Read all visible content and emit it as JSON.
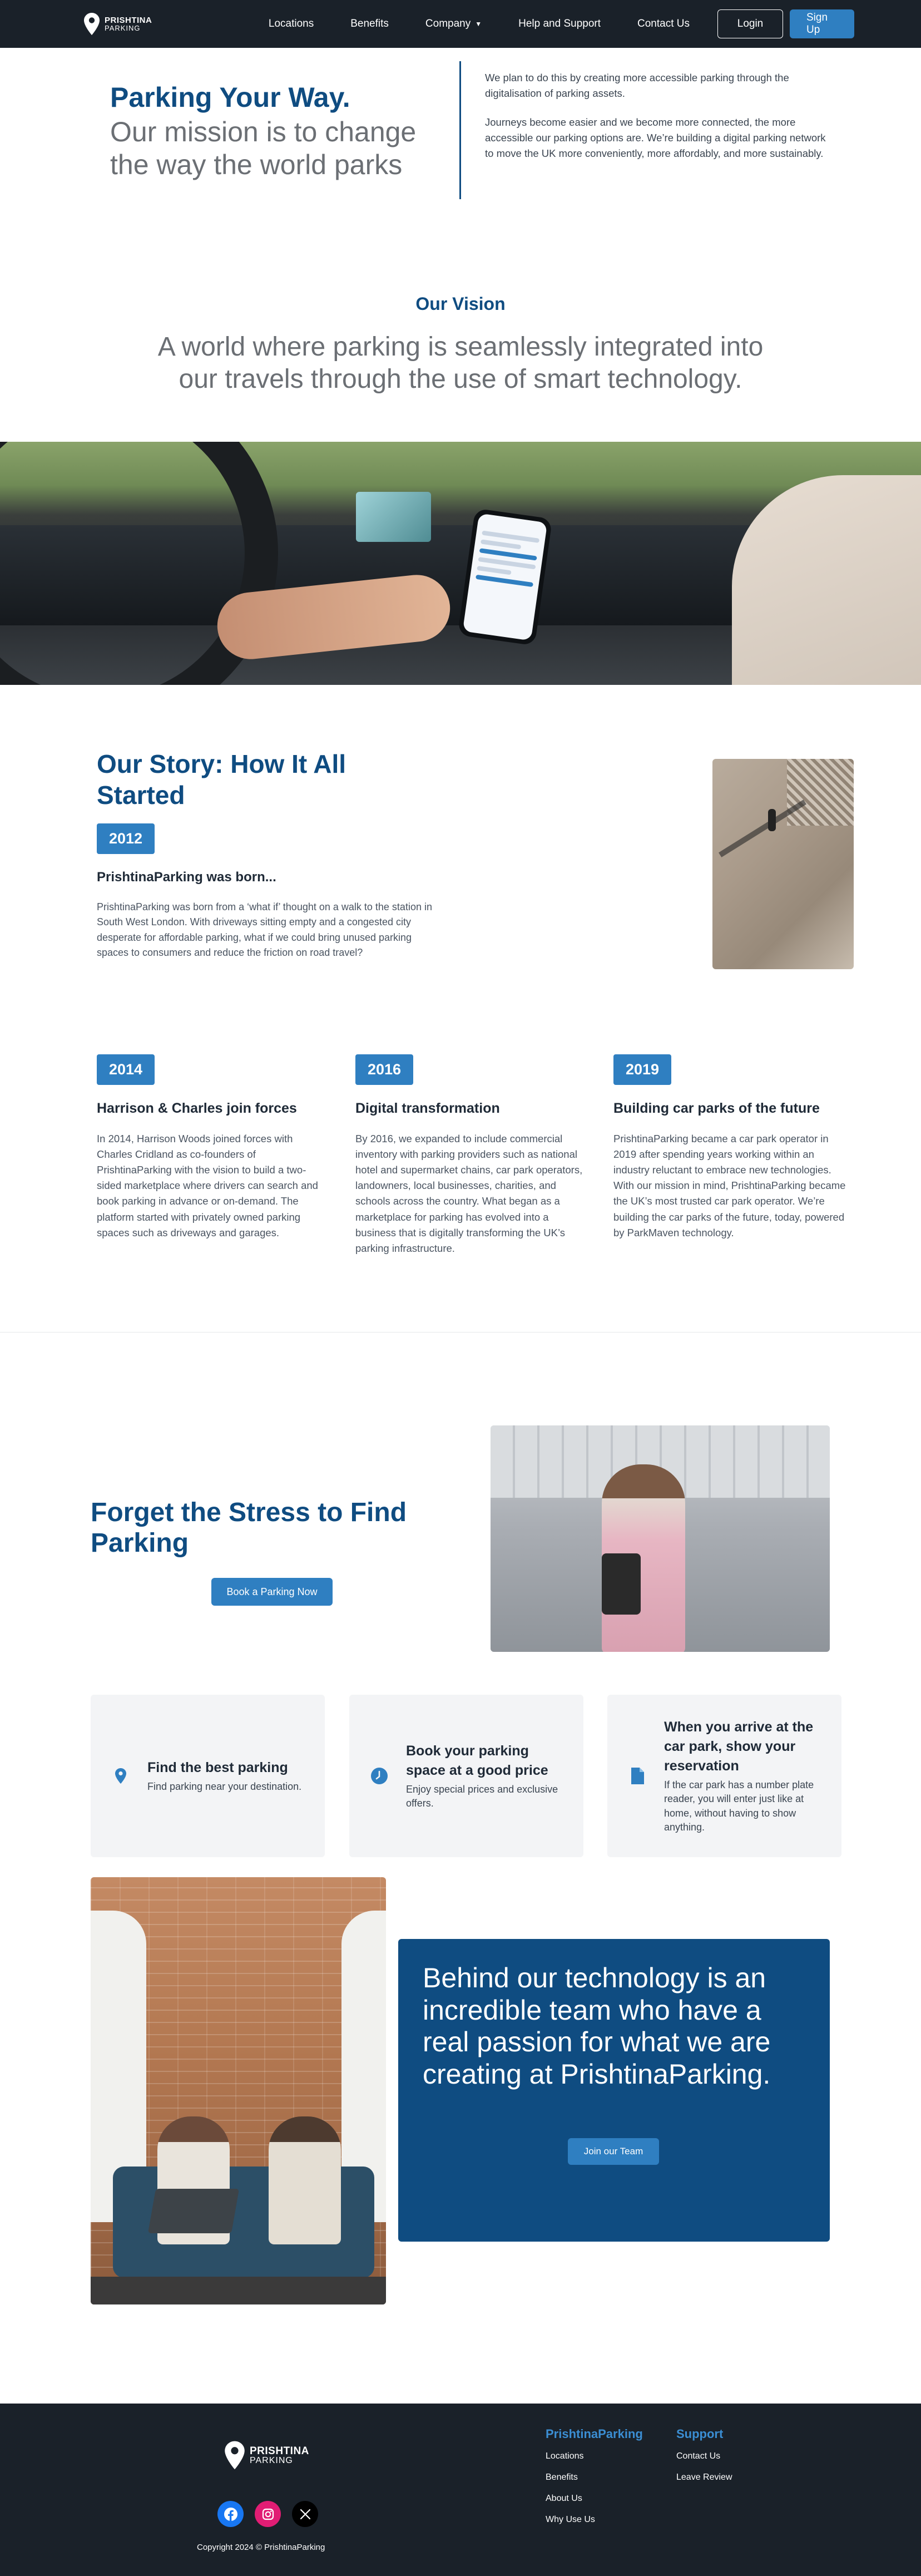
{
  "brand": {
    "name_line1": "PRISHTINA",
    "name_line2": "PARKING"
  },
  "nav": {
    "links": [
      "Locations",
      "Benefits",
      "Company",
      "Help and Support",
      "Contact Us"
    ],
    "login": "Login",
    "signup": "Sign Up"
  },
  "mission": {
    "title": "Parking Your Way.",
    "subtitle": "Our mission is to change the way the world parks",
    "p1": "We plan to do this by creating more accessible parking through the digitalisation of parking assets.",
    "p2": "Journeys become easier and we become more connected, the more accessible our parking options are. We’re building a digital parking network to move the UK more conveniently, more affordably, and more sustainably."
  },
  "vision": {
    "title": "Our Vision",
    "text": "A world where parking is seamlessly integrated into our travels through the use of smart technology."
  },
  "story": {
    "title": "Our Story: How It All Started",
    "entries": [
      {
        "year": "2012",
        "title": "PrishtinaParking was born...",
        "text": "PrishtinaParking was born from a ‘what if’ thought on a walk to the station in South West London. With driveways sitting empty and a congested city desperate for affordable parking, what if we could bring unused parking spaces to consumers and reduce the friction on road travel?"
      },
      {
        "year": "2014",
        "title": "Harrison & Charles join forces",
        "text": "In 2014, Harrison Woods joined forces with Charles Cridland as co-founders of PrishtinaParking with the vision to build a two-sided marketplace where drivers can search and book parking in advance or on-demand. The platform started with privately owned parking spaces such as driveways and garages."
      },
      {
        "year": "2016",
        "title": "Digital transformation",
        "text": "By 2016, we expanded to include commercial inventory with parking providers such as national hotel and supermarket chains, car park operators, landowners, local businesses, charities, and schools across the country. What began as a marketplace for parking has evolved into a business that is digitally transforming the UK’s parking infrastructure."
      },
      {
        "year": "2019",
        "title": "Building car parks of the future",
        "text": "PrishtinaParking became a car park operator in 2019 after spending years working within an industry reluctant to embrace new technologies. With our mission in mind, PrishtinaParking became the UK’s most trusted car park operator. We’re building the car parks of the future, today, powered by ParkMaven technology."
      }
    ]
  },
  "stress": {
    "title": "Forget the Stress to Find Parking",
    "button": "Book a Parking Now"
  },
  "features": [
    {
      "icon": "location-pin-icon",
      "title": "Find the best parking",
      "desc": "Find parking near your destination."
    },
    {
      "icon": "clock-icon",
      "title": "Book your parking space at a good price",
      "desc": "Enjoy special prices and exclusive offers."
    },
    {
      "icon": "document-icon",
      "title": "When you arrive at the car park, show your reservation",
      "desc": "If the car park has a number plate reader, you will enter just like at home, without having to show anything."
    }
  ],
  "team": {
    "text": "Behind our technology is an incredible team who have a real passion for what we are creating at PrishtinaParking.",
    "button": "Join our Team"
  },
  "footer": {
    "col1": {
      "title": "PrishtinaParking",
      "links": [
        "Locations",
        "Benefits",
        "About Us",
        "Why Use Us"
      ]
    },
    "col2": {
      "title": "Support",
      "links": [
        "Contact Us",
        "Leave Review"
      ]
    },
    "socials": [
      "facebook-icon",
      "instagram-icon",
      "x-icon"
    ],
    "copyright": "Copyright 2024 © PrishtinaParking"
  },
  "colors": {
    "primary": "#0f4c81",
    "accent": "#2f7fc1",
    "dark": "#1a2129"
  }
}
